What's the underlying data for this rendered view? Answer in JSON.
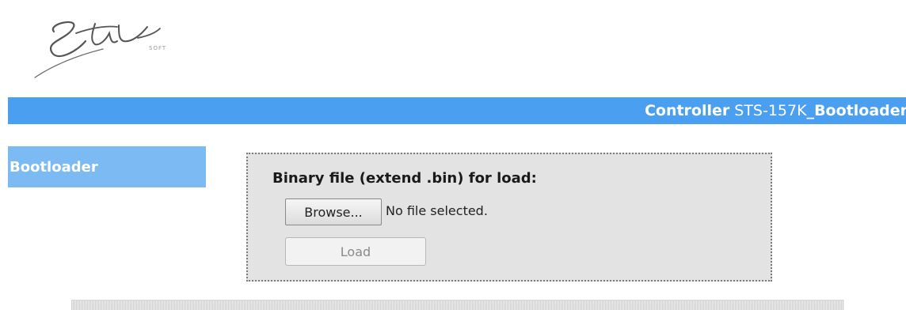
{
  "logo": {
    "script_text": "Stil",
    "sub_text": "SOFT"
  },
  "header": {
    "controller_label": "Controller",
    "controller_model": "STS-157K",
    "controller_name": "_Bootloader"
  },
  "sidebar": {
    "items": [
      {
        "label": "Bootloader"
      }
    ]
  },
  "upload": {
    "title": "Binary file (extend .bin) for load:",
    "browse_label": "Browse...",
    "file_status": "No file selected.",
    "load_label": "Load"
  },
  "colors": {
    "header_bg": "#4a9ff0",
    "sidebar_item_bg": "#7bbaf2",
    "panel_bg": "#e3e3e3"
  }
}
